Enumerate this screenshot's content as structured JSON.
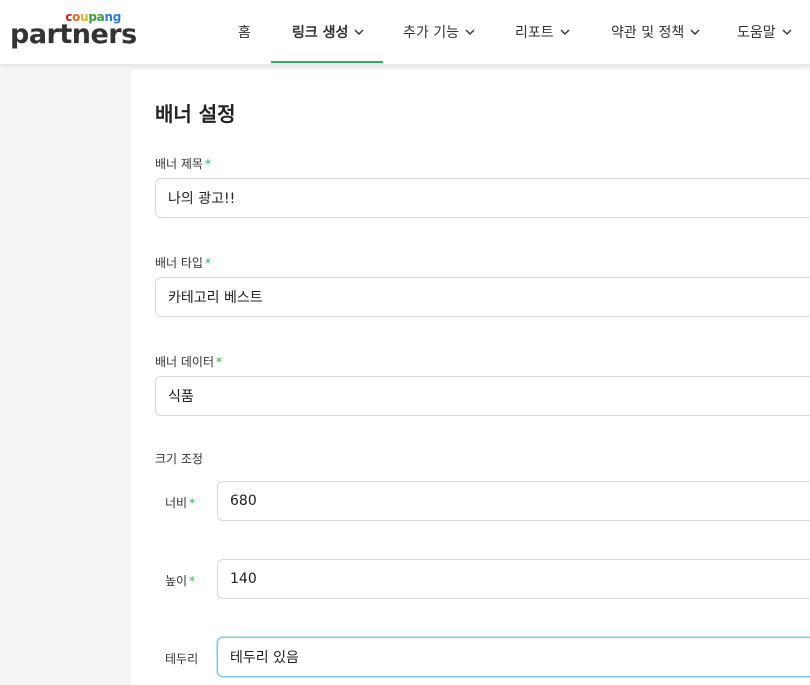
{
  "logo": {
    "top": [
      "c",
      "o",
      "u",
      "p",
      "a",
      "n",
      "g"
    ],
    "top_colors": [
      "#c8251f",
      "#d86c24",
      "#e3b125",
      "#3b9d3f",
      "#3b9d3f",
      "#2f7bd4",
      "#2f7bd4"
    ],
    "main": "partners"
  },
  "nav": {
    "items": [
      {
        "label": "홈"
      },
      {
        "label": "링크 생성",
        "active": true
      },
      {
        "label": "추가 기능"
      },
      {
        "label": "리포트"
      },
      {
        "label": "약관 및 정책"
      },
      {
        "label": "도움말"
      }
    ],
    "accent": "#2bb05f"
  },
  "page": {
    "title": "배너 설정"
  },
  "form": {
    "banner_title": {
      "label": "배너 제목",
      "required_mark": "*",
      "value": "나의 광고!!"
    },
    "banner_type": {
      "label": "배너 타입",
      "required_mark": "*",
      "value": "카테고리 베스트"
    },
    "banner_data": {
      "label": "배너 데이터",
      "required_mark": "*",
      "value": "식품"
    },
    "size_section": {
      "label": "크기 조정"
    },
    "width": {
      "label": "너비",
      "required_mark": "*",
      "value": "680"
    },
    "height": {
      "label": "높이",
      "required_mark": "*",
      "value": "140"
    },
    "border": {
      "label": "테두리",
      "value": "테두리 있음"
    }
  }
}
